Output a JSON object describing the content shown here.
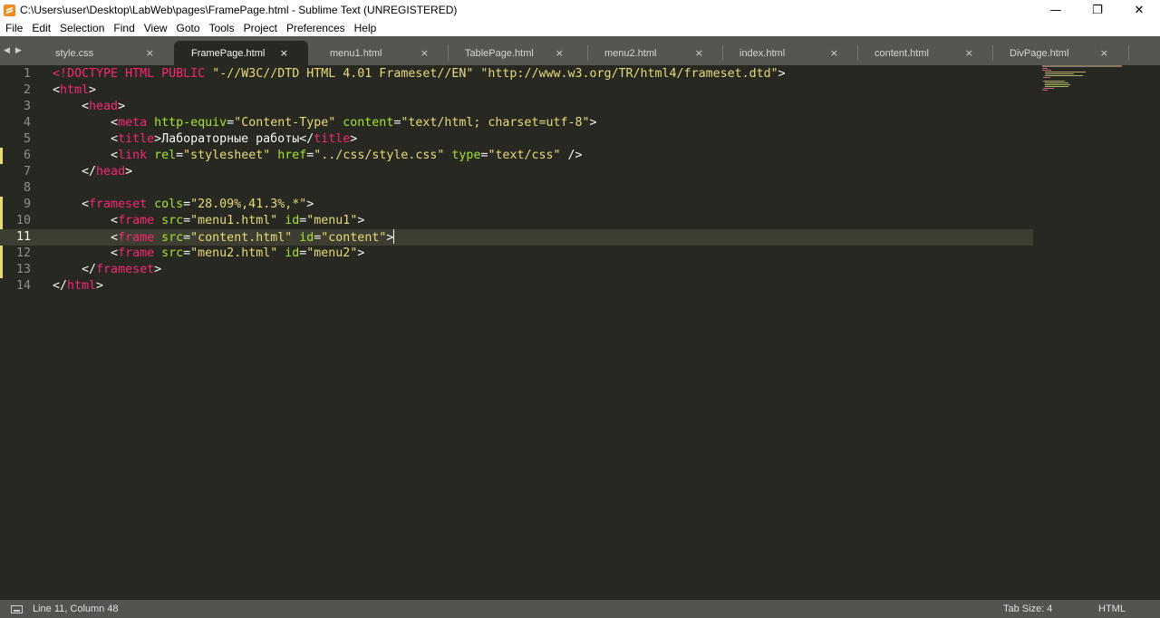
{
  "window": {
    "title": "C:\\Users\\user\\Desktop\\LabWeb\\pages\\FramePage.html - Sublime Text (UNREGISTERED)",
    "controls": {
      "minimize": "—",
      "maximize": "❐",
      "close": "✕"
    }
  },
  "menu": [
    "File",
    "Edit",
    "Selection",
    "Find",
    "View",
    "Goto",
    "Tools",
    "Project",
    "Preferences",
    "Help"
  ],
  "tabs": [
    {
      "label": "style.css",
      "active": false
    },
    {
      "label": "FramePage.html",
      "active": true
    },
    {
      "label": "menu1.html",
      "active": false
    },
    {
      "label": "TablePage.html",
      "active": false
    },
    {
      "label": "menu2.html",
      "active": false
    },
    {
      "label": "index.html",
      "active": false
    },
    {
      "label": "content.html",
      "active": false
    },
    {
      "label": "DivPage.html",
      "active": false
    }
  ],
  "tab_close_glyph": "×",
  "tab_nav": {
    "prev": "◀",
    "next": "▶"
  },
  "editor": {
    "current_line": 11,
    "lines": [
      {
        "n": "1",
        "tokens": [
          [
            "tag",
            "<!DOCTYPE"
          ],
          [
            "txt",
            " "
          ],
          [
            "tag",
            "HTML"
          ],
          [
            "txt",
            " "
          ],
          [
            "tag",
            "PUBLIC"
          ],
          [
            "txt",
            " "
          ],
          [
            "str",
            "\"-//W3C//DTD HTML 4.01 Frameset//EN\""
          ],
          [
            "txt",
            " "
          ],
          [
            "str",
            "\"http://www.w3.org/TR/html4/frameset.dtd\""
          ],
          [
            "txt",
            ">"
          ]
        ]
      },
      {
        "n": "2",
        "tokens": [
          [
            "txt",
            "<"
          ],
          [
            "tag",
            "html"
          ],
          [
            "txt",
            ">"
          ]
        ]
      },
      {
        "n": "3",
        "tokens": [
          [
            "txt",
            "    <"
          ],
          [
            "tag",
            "head"
          ],
          [
            "txt",
            ">"
          ]
        ]
      },
      {
        "n": "4",
        "tokens": [
          [
            "txt",
            "        <"
          ],
          [
            "tag",
            "meta"
          ],
          [
            "txt",
            " "
          ],
          [
            "attr",
            "http-equiv"
          ],
          [
            "txt",
            "="
          ],
          [
            "str",
            "\"Content-Type\""
          ],
          [
            "txt",
            " "
          ],
          [
            "attr",
            "content"
          ],
          [
            "txt",
            "="
          ],
          [
            "str",
            "\"text/html; charset=utf-8\""
          ],
          [
            "txt",
            ">"
          ]
        ]
      },
      {
        "n": "5",
        "tokens": [
          [
            "txt",
            "        <"
          ],
          [
            "tag",
            "title"
          ],
          [
            "txt",
            ">Лабораторные работы</"
          ],
          [
            "tag",
            "title"
          ],
          [
            "txt",
            ">"
          ]
        ]
      },
      {
        "n": "6",
        "tokens": [
          [
            "txt",
            "        <"
          ],
          [
            "tag",
            "link"
          ],
          [
            "txt",
            " "
          ],
          [
            "attr",
            "rel"
          ],
          [
            "txt",
            "="
          ],
          [
            "str",
            "\"stylesheet\""
          ],
          [
            "txt",
            " "
          ],
          [
            "attr",
            "href"
          ],
          [
            "txt",
            "="
          ],
          [
            "str",
            "\"../css/style.css\""
          ],
          [
            "txt",
            " "
          ],
          [
            "attr",
            "type"
          ],
          [
            "txt",
            "="
          ],
          [
            "str",
            "\"text/css\""
          ],
          [
            "txt",
            " />"
          ]
        ]
      },
      {
        "n": "7",
        "tokens": [
          [
            "txt",
            "    </"
          ],
          [
            "tag",
            "head"
          ],
          [
            "txt",
            ">"
          ]
        ]
      },
      {
        "n": "8",
        "tokens": []
      },
      {
        "n": "9",
        "tokens": [
          [
            "txt",
            "    <"
          ],
          [
            "tag",
            "frameset"
          ],
          [
            "txt",
            " "
          ],
          [
            "attr",
            "cols"
          ],
          [
            "txt",
            "="
          ],
          [
            "str",
            "\"28.09%,41.3%,*\""
          ],
          [
            "txt",
            ">"
          ]
        ]
      },
      {
        "n": "10",
        "tokens": [
          [
            "txt",
            "        <"
          ],
          [
            "tag",
            "frame"
          ],
          [
            "txt",
            " "
          ],
          [
            "attr",
            "src"
          ],
          [
            "txt",
            "="
          ],
          [
            "str",
            "\"menu1.html\""
          ],
          [
            "txt",
            " "
          ],
          [
            "attr",
            "id"
          ],
          [
            "txt",
            "="
          ],
          [
            "str",
            "\"menu1\""
          ],
          [
            "txt",
            ">"
          ]
        ]
      },
      {
        "n": "11",
        "tokens": [
          [
            "txt",
            "        <"
          ],
          [
            "tag",
            "frame"
          ],
          [
            "txt",
            " "
          ],
          [
            "attr",
            "src"
          ],
          [
            "txt",
            "="
          ],
          [
            "str",
            "\"content.html\""
          ],
          [
            "txt",
            " "
          ],
          [
            "attr",
            "id"
          ],
          [
            "txt",
            "="
          ],
          [
            "str",
            "\"content\""
          ],
          [
            "txt",
            ">"
          ]
        ]
      },
      {
        "n": "12",
        "tokens": [
          [
            "txt",
            "        <"
          ],
          [
            "tag",
            "frame"
          ],
          [
            "txt",
            " "
          ],
          [
            "attr",
            "src"
          ],
          [
            "txt",
            "="
          ],
          [
            "str",
            "\"menu2.html\""
          ],
          [
            "txt",
            " "
          ],
          [
            "attr",
            "id"
          ],
          [
            "txt",
            "="
          ],
          [
            "str",
            "\"menu2\""
          ],
          [
            "txt",
            ">"
          ]
        ]
      },
      {
        "n": "13",
        "tokens": [
          [
            "txt",
            "    </"
          ],
          [
            "tag",
            "frameset"
          ],
          [
            "txt",
            ">"
          ]
        ]
      },
      {
        "n": "14",
        "tokens": [
          [
            "txt",
            "</"
          ],
          [
            "tag",
            "html"
          ],
          [
            "txt",
            ">"
          ]
        ]
      }
    ],
    "modified_lines": [
      6,
      9,
      10,
      11,
      12,
      13
    ]
  },
  "colors": {
    "background": "#272822",
    "tag": "#f92672",
    "attribute": "#a6e22e",
    "string": "#e6db74",
    "text": "#f8f8f2",
    "line_number": "#90908a"
  },
  "status": {
    "position": "Line 11, Column 48",
    "tab_size": "Tab Size: 4",
    "syntax": "HTML"
  }
}
